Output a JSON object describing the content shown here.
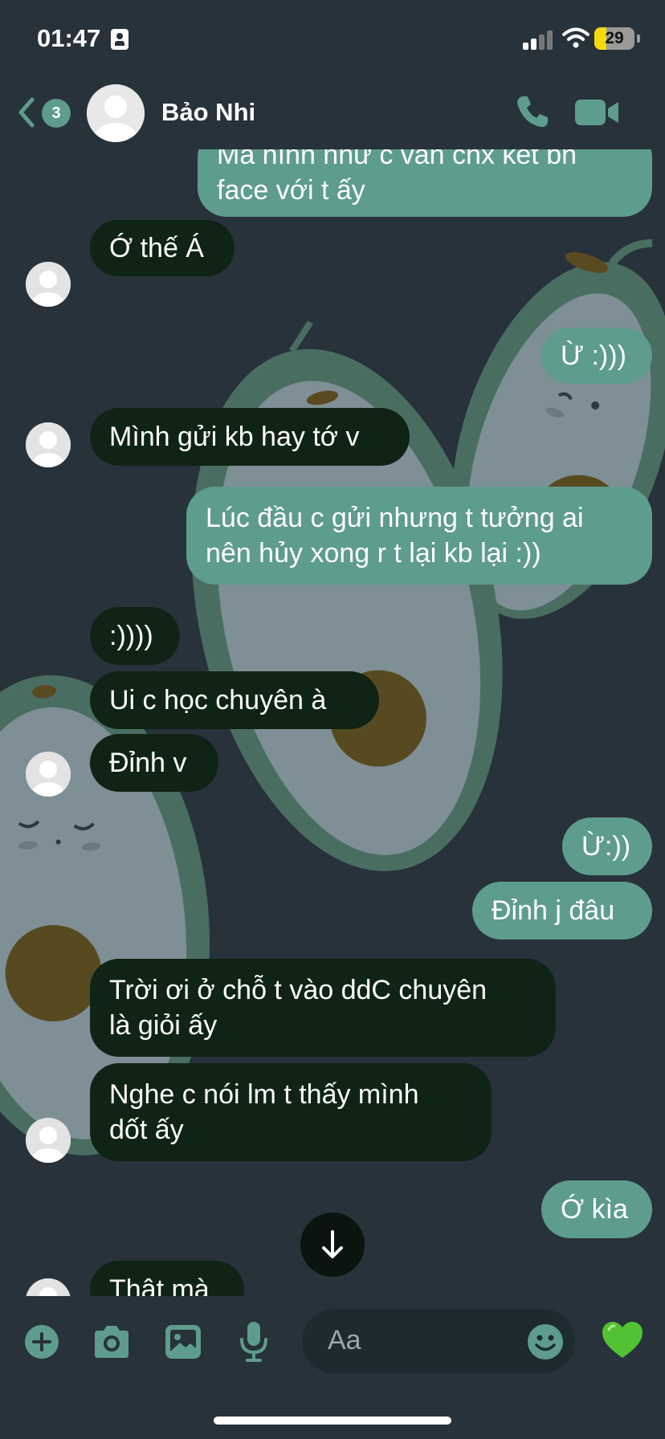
{
  "status_bar": {
    "time": "01:47",
    "battery": "29",
    "battery_level": 0.29
  },
  "header": {
    "back_count": "3",
    "contact_name": "Bảo Nhi"
  },
  "messages": [
    {
      "from": "me",
      "lines": [
        "Mà hình như c vẫn chx kết bn",
        "face với t ấy"
      ]
    },
    {
      "from": "them",
      "lines": [
        "Ớ thế Á"
      ]
    },
    {
      "from": "me",
      "lines": [
        "Ừ :)))"
      ]
    },
    {
      "from": "them",
      "lines": [
        "Mình gửi kb hay tớ v"
      ]
    },
    {
      "from": "me",
      "lines": [
        "Lúc đầu c gửi nhưng t tưởng ai",
        "nên hủy xong r t lại kb lại :))"
      ]
    },
    {
      "from": "them",
      "lines": [
        ":))))"
      ]
    },
    {
      "from": "them",
      "lines": [
        "Ui c học chuyên à"
      ]
    },
    {
      "from": "them",
      "lines": [
        "Đỉnh v"
      ]
    },
    {
      "from": "me",
      "lines": [
        "Ừ:))"
      ]
    },
    {
      "from": "me",
      "lines": [
        "Đỉnh j đâu"
      ]
    },
    {
      "from": "them",
      "lines": [
        "Trời ơi ở chỗ t vào ddC chuyên",
        "là giỏi ấy"
      ]
    },
    {
      "from": "them",
      "lines": [
        "Nghe c nói lm t thấy mình",
        "dốt ấy"
      ]
    },
    {
      "from": "me",
      "lines": [
        "Ớ kìa"
      ]
    },
    {
      "from": "them",
      "lines": [
        "Thật mà"
      ]
    }
  ],
  "composer": {
    "placeholder": "Aa"
  },
  "icons": {
    "back": "chevron-left-icon",
    "call": "phone-icon",
    "video": "video-camera-icon",
    "add": "plus-icon",
    "camera": "camera-icon",
    "gallery": "image-icon",
    "mic": "microphone-icon",
    "emoji": "smiley-icon",
    "like": "green-heart-icon",
    "scroll": "arrow-down-icon"
  },
  "colors": {
    "background": "#27323a",
    "accent": "#5e9c8e",
    "incoming_bubble": "#0f2415",
    "outgoing_bubble": "#5e9c8e"
  }
}
